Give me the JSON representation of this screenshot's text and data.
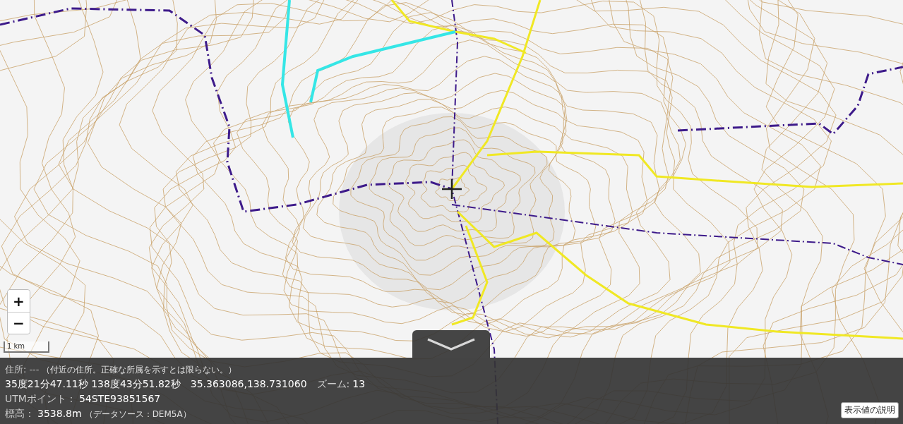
{
  "zoom_control": {
    "zoom_in": "+",
    "zoom_out": "−"
  },
  "scale_bar": {
    "label": "1 km"
  },
  "info_panel": {
    "address": {
      "label": "住所:",
      "value": "---",
      "note": "（付近の住所。正確な所属を示すとは限らない。）"
    },
    "coordinates": {
      "dms": "35度21分47.11秒 138度43分51.82秒",
      "decimal": "35.363086,138.731060",
      "zoom_label": "ズーム:",
      "zoom_value": "13"
    },
    "utm": {
      "label": "UTMポイント：",
      "value": "54STE93851567"
    },
    "elevation": {
      "label": "標高：",
      "value": "3538.8m",
      "note": "（データソース：DEM5A）"
    },
    "help_button": "表示値の説明"
  }
}
